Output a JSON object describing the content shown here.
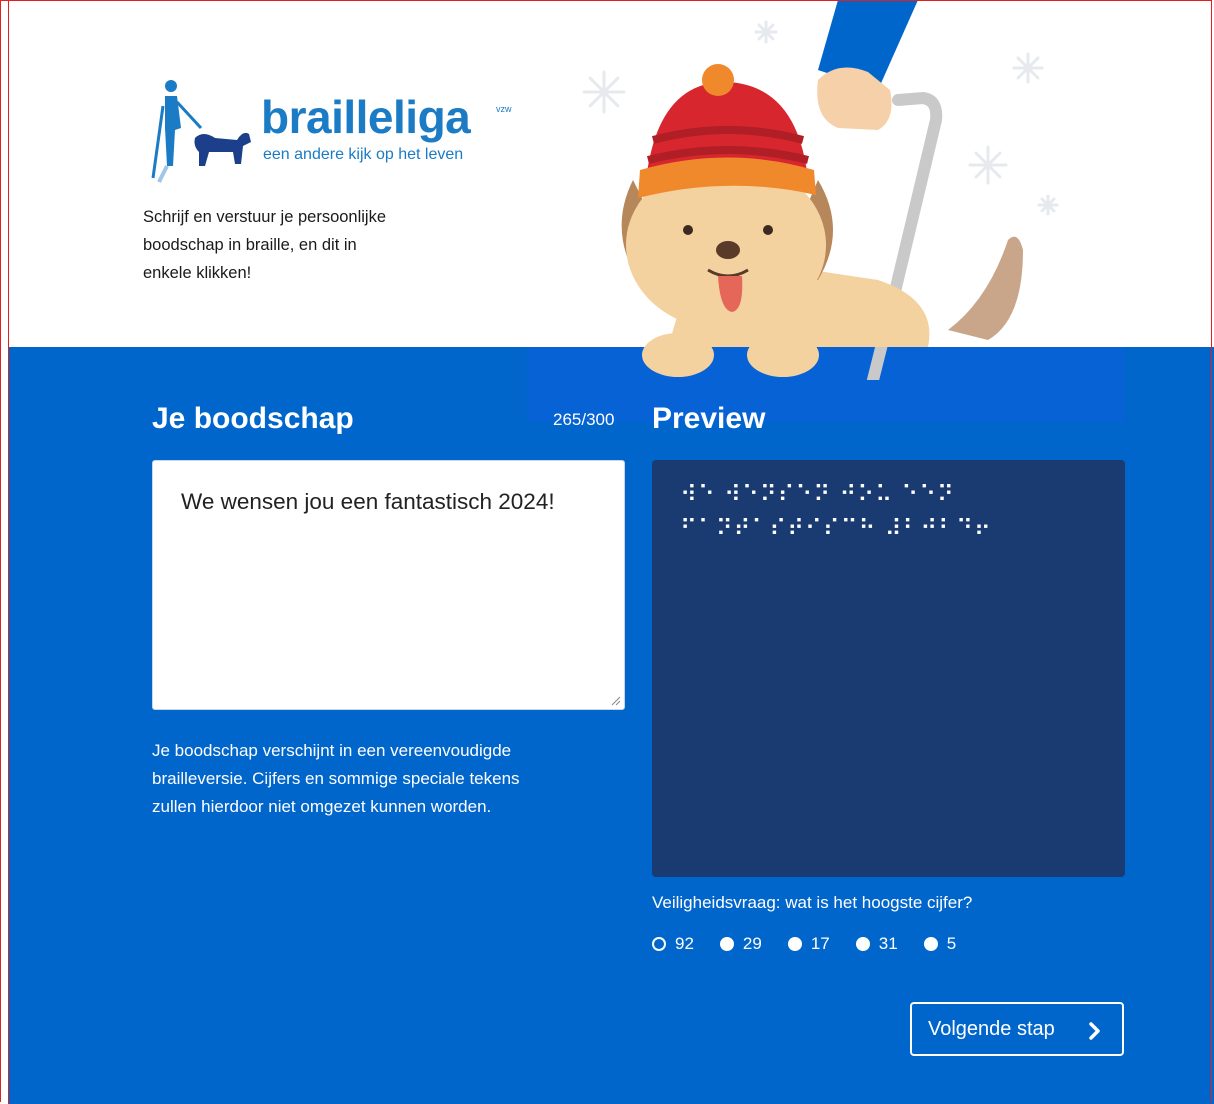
{
  "brand": {
    "name": "brailleliga",
    "suffix": "vzw",
    "tagline": "een andere kijk op het leven"
  },
  "intro": {
    "line1": "Schrijf en verstuur je persoonlijke",
    "line2": "boodschap in braille, en dit in",
    "line3": "enkele klikken!"
  },
  "message": {
    "title": "Je boodschap",
    "counter": "265/300",
    "text": "We wensen jou een fantastisch 2024!",
    "help_line1": "Je boodschap verschijnt in een vereenvoudigde",
    "help_line2": "brailleversie. Cijfers en sommige speciale tekens",
    "help_line3": "zullen hierdoor niet omgezet kunnen worden."
  },
  "preview": {
    "title": "Preview",
    "braille_line1": "⠺⠑ ⠺⠑⠝⠎⠑⠝ ⠚⠕⠥ ⠑⠑⠝",
    "braille_line2": "⠋⠁⠝⠞⠁⠎⠞⠊⠎⠉⠓ ⠼⠃⠚⠃⠙⠖"
  },
  "security": {
    "question": "Veiligheidsvraag: wat is het hoogste cijfer?",
    "options": [
      "92",
      "29",
      "17",
      "31",
      "5"
    ],
    "selected": "92"
  },
  "next_button": {
    "label": "Volgende stap"
  },
  "colors": {
    "brand_blue": "#1b7bc4",
    "panel_blue": "#0066cc",
    "preview_navy": "#1a3b72"
  }
}
